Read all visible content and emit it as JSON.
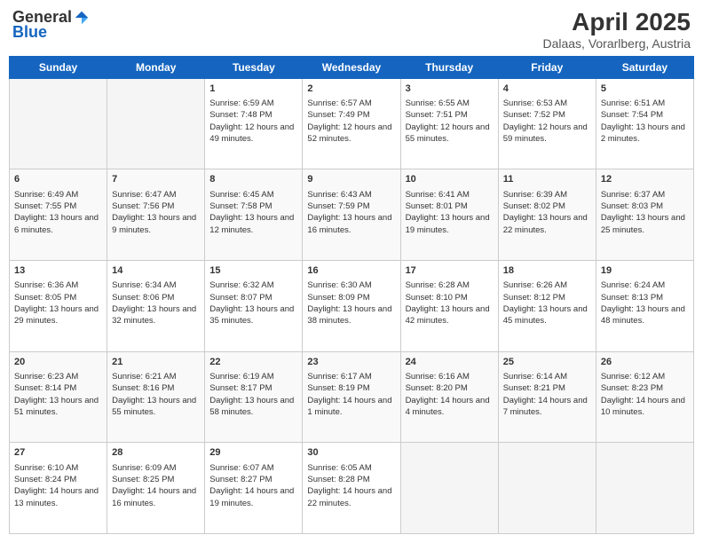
{
  "header": {
    "logo_general": "General",
    "logo_blue": "Blue",
    "month": "April 2025",
    "location": "Dalaas, Vorarlberg, Austria"
  },
  "weekdays": [
    "Sunday",
    "Monday",
    "Tuesday",
    "Wednesday",
    "Thursday",
    "Friday",
    "Saturday"
  ],
  "weeks": [
    [
      {
        "day": "",
        "sunrise": "",
        "sunset": "",
        "daylight": ""
      },
      {
        "day": "",
        "sunrise": "",
        "sunset": "",
        "daylight": ""
      },
      {
        "day": "1",
        "sunrise": "Sunrise: 6:59 AM",
        "sunset": "Sunset: 7:48 PM",
        "daylight": "Daylight: 12 hours and 49 minutes."
      },
      {
        "day": "2",
        "sunrise": "Sunrise: 6:57 AM",
        "sunset": "Sunset: 7:49 PM",
        "daylight": "Daylight: 12 hours and 52 minutes."
      },
      {
        "day": "3",
        "sunrise": "Sunrise: 6:55 AM",
        "sunset": "Sunset: 7:51 PM",
        "daylight": "Daylight: 12 hours and 55 minutes."
      },
      {
        "day": "4",
        "sunrise": "Sunrise: 6:53 AM",
        "sunset": "Sunset: 7:52 PM",
        "daylight": "Daylight: 12 hours and 59 minutes."
      },
      {
        "day": "5",
        "sunrise": "Sunrise: 6:51 AM",
        "sunset": "Sunset: 7:54 PM",
        "daylight": "Daylight: 13 hours and 2 minutes."
      }
    ],
    [
      {
        "day": "6",
        "sunrise": "Sunrise: 6:49 AM",
        "sunset": "Sunset: 7:55 PM",
        "daylight": "Daylight: 13 hours and 6 minutes."
      },
      {
        "day": "7",
        "sunrise": "Sunrise: 6:47 AM",
        "sunset": "Sunset: 7:56 PM",
        "daylight": "Daylight: 13 hours and 9 minutes."
      },
      {
        "day": "8",
        "sunrise": "Sunrise: 6:45 AM",
        "sunset": "Sunset: 7:58 PM",
        "daylight": "Daylight: 13 hours and 12 minutes."
      },
      {
        "day": "9",
        "sunrise": "Sunrise: 6:43 AM",
        "sunset": "Sunset: 7:59 PM",
        "daylight": "Daylight: 13 hours and 16 minutes."
      },
      {
        "day": "10",
        "sunrise": "Sunrise: 6:41 AM",
        "sunset": "Sunset: 8:01 PM",
        "daylight": "Daylight: 13 hours and 19 minutes."
      },
      {
        "day": "11",
        "sunrise": "Sunrise: 6:39 AM",
        "sunset": "Sunset: 8:02 PM",
        "daylight": "Daylight: 13 hours and 22 minutes."
      },
      {
        "day": "12",
        "sunrise": "Sunrise: 6:37 AM",
        "sunset": "Sunset: 8:03 PM",
        "daylight": "Daylight: 13 hours and 25 minutes."
      }
    ],
    [
      {
        "day": "13",
        "sunrise": "Sunrise: 6:36 AM",
        "sunset": "Sunset: 8:05 PM",
        "daylight": "Daylight: 13 hours and 29 minutes."
      },
      {
        "day": "14",
        "sunrise": "Sunrise: 6:34 AM",
        "sunset": "Sunset: 8:06 PM",
        "daylight": "Daylight: 13 hours and 32 minutes."
      },
      {
        "day": "15",
        "sunrise": "Sunrise: 6:32 AM",
        "sunset": "Sunset: 8:07 PM",
        "daylight": "Daylight: 13 hours and 35 minutes."
      },
      {
        "day": "16",
        "sunrise": "Sunrise: 6:30 AM",
        "sunset": "Sunset: 8:09 PM",
        "daylight": "Daylight: 13 hours and 38 minutes."
      },
      {
        "day": "17",
        "sunrise": "Sunrise: 6:28 AM",
        "sunset": "Sunset: 8:10 PM",
        "daylight": "Daylight: 13 hours and 42 minutes."
      },
      {
        "day": "18",
        "sunrise": "Sunrise: 6:26 AM",
        "sunset": "Sunset: 8:12 PM",
        "daylight": "Daylight: 13 hours and 45 minutes."
      },
      {
        "day": "19",
        "sunrise": "Sunrise: 6:24 AM",
        "sunset": "Sunset: 8:13 PM",
        "daylight": "Daylight: 13 hours and 48 minutes."
      }
    ],
    [
      {
        "day": "20",
        "sunrise": "Sunrise: 6:23 AM",
        "sunset": "Sunset: 8:14 PM",
        "daylight": "Daylight: 13 hours and 51 minutes."
      },
      {
        "day": "21",
        "sunrise": "Sunrise: 6:21 AM",
        "sunset": "Sunset: 8:16 PM",
        "daylight": "Daylight: 13 hours and 55 minutes."
      },
      {
        "day": "22",
        "sunrise": "Sunrise: 6:19 AM",
        "sunset": "Sunset: 8:17 PM",
        "daylight": "Daylight: 13 hours and 58 minutes."
      },
      {
        "day": "23",
        "sunrise": "Sunrise: 6:17 AM",
        "sunset": "Sunset: 8:19 PM",
        "daylight": "Daylight: 14 hours and 1 minute."
      },
      {
        "day": "24",
        "sunrise": "Sunrise: 6:16 AM",
        "sunset": "Sunset: 8:20 PM",
        "daylight": "Daylight: 14 hours and 4 minutes."
      },
      {
        "day": "25",
        "sunrise": "Sunrise: 6:14 AM",
        "sunset": "Sunset: 8:21 PM",
        "daylight": "Daylight: 14 hours and 7 minutes."
      },
      {
        "day": "26",
        "sunrise": "Sunrise: 6:12 AM",
        "sunset": "Sunset: 8:23 PM",
        "daylight": "Daylight: 14 hours and 10 minutes."
      }
    ],
    [
      {
        "day": "27",
        "sunrise": "Sunrise: 6:10 AM",
        "sunset": "Sunset: 8:24 PM",
        "daylight": "Daylight: 14 hours and 13 minutes."
      },
      {
        "day": "28",
        "sunrise": "Sunrise: 6:09 AM",
        "sunset": "Sunset: 8:25 PM",
        "daylight": "Daylight: 14 hours and 16 minutes."
      },
      {
        "day": "29",
        "sunrise": "Sunrise: 6:07 AM",
        "sunset": "Sunset: 8:27 PM",
        "daylight": "Daylight: 14 hours and 19 minutes."
      },
      {
        "day": "30",
        "sunrise": "Sunrise: 6:05 AM",
        "sunset": "Sunset: 8:28 PM",
        "daylight": "Daylight: 14 hours and 22 minutes."
      },
      {
        "day": "",
        "sunrise": "",
        "sunset": "",
        "daylight": ""
      },
      {
        "day": "",
        "sunrise": "",
        "sunset": "",
        "daylight": ""
      },
      {
        "day": "",
        "sunrise": "",
        "sunset": "",
        "daylight": ""
      }
    ]
  ]
}
